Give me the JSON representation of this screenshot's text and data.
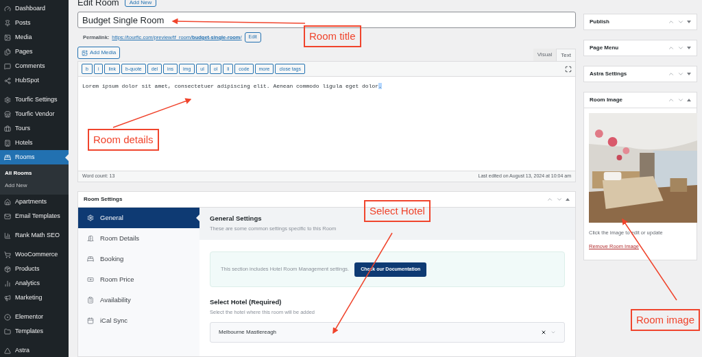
{
  "sidebar": {
    "groups": [
      [
        {
          "label": "Dashboard",
          "selected": false
        },
        {
          "label": "Posts",
          "selected": false
        },
        {
          "label": "Media",
          "selected": false
        },
        {
          "label": "Pages",
          "selected": false
        },
        {
          "label": "Comments",
          "selected": false
        },
        {
          "label": "HubSpot",
          "selected": false
        }
      ],
      [
        {
          "label": "Tourfic Settings",
          "selected": false
        },
        {
          "label": "Tourfic Vendor",
          "selected": false
        },
        {
          "label": "Tours",
          "selected": false
        },
        {
          "label": "Hotels",
          "selected": false
        },
        {
          "label": "Rooms",
          "selected": true,
          "children": [
            {
              "label": "All Rooms",
              "selected": true
            },
            {
              "label": "Add New",
              "selected": false
            }
          ]
        },
        {
          "label": "Apartments",
          "selected": false
        },
        {
          "label": "Email Templates",
          "selected": false
        }
      ],
      [
        {
          "label": "Rank Math SEO",
          "selected": false
        }
      ],
      [
        {
          "label": "WooCommerce",
          "selected": false
        },
        {
          "label": "Products",
          "selected": false
        },
        {
          "label": "Analytics",
          "selected": false
        },
        {
          "label": "Marketing",
          "selected": false
        }
      ],
      [
        {
          "label": "Elementor",
          "selected": false
        },
        {
          "label": "Templates",
          "selected": false
        }
      ],
      [
        {
          "label": "Astra",
          "selected": false
        }
      ]
    ]
  },
  "header": {
    "title": "Edit Room",
    "add_new": "Add New"
  },
  "title_field": {
    "value": "Budget Single Room"
  },
  "permalink": {
    "label": "Permalink:",
    "url": "https://tourfic.com/preview/tf_room/**budget-single-room**/",
    "edit": "Edit"
  },
  "editor": {
    "add_media": "Add Media",
    "tabs": [
      {
        "label": "Visual",
        "selected": false
      },
      {
        "label": "Text",
        "selected": true
      }
    ],
    "toolbar": [
      "b",
      "i",
      "link",
      "b-quote",
      "del",
      "ins",
      "img",
      "ul",
      "ol",
      "li",
      "code",
      "more",
      "close tags"
    ],
    "content": "Lorem ipsum dolor sit amet, consectetuer adipiscing elit. Aenean commodo ligula eget dolor",
    "selected_text": ".",
    "word_count": "Word count: 13",
    "last_edited": "Last edited on August 13, 2024 at 10:04 am"
  },
  "room_settings": {
    "title": "Room Settings",
    "expanded": true,
    "tabs": [
      {
        "label": "General",
        "selected": true
      },
      {
        "label": "Room Details",
        "selected": false
      },
      {
        "label": "Booking",
        "selected": false
      },
      {
        "label": "Room Price",
        "selected": false
      },
      {
        "label": "Availability",
        "selected": false
      },
      {
        "label": "iCal Sync",
        "selected": false
      }
    ],
    "section_title": "General Settings",
    "section_subtitle": "These are some common settings specific to this Room",
    "notice": {
      "text": "This section includes Hotel Room Management settings.",
      "button": "Check our Documentation"
    },
    "field": {
      "label": "Select Hotel (Required)",
      "hint": "Select the hotel where this room will be added",
      "value": "Melbourne Mastlereagh"
    }
  },
  "side_boxes": [
    {
      "title": "Publish",
      "expanded": false
    },
    {
      "title": "Page Menu",
      "expanded": false
    },
    {
      "title": "Astra Settings",
      "expanded": false
    },
    {
      "title": "Room Image",
      "expanded": true,
      "hint": "Click the image to edit or update",
      "remove_link": "Remove Room Image"
    }
  ],
  "annotations": [
    {
      "text": "Room title"
    },
    {
      "text": "Room details"
    },
    {
      "text": "Select Hotel"
    },
    {
      "text": "Room image"
    }
  ]
}
